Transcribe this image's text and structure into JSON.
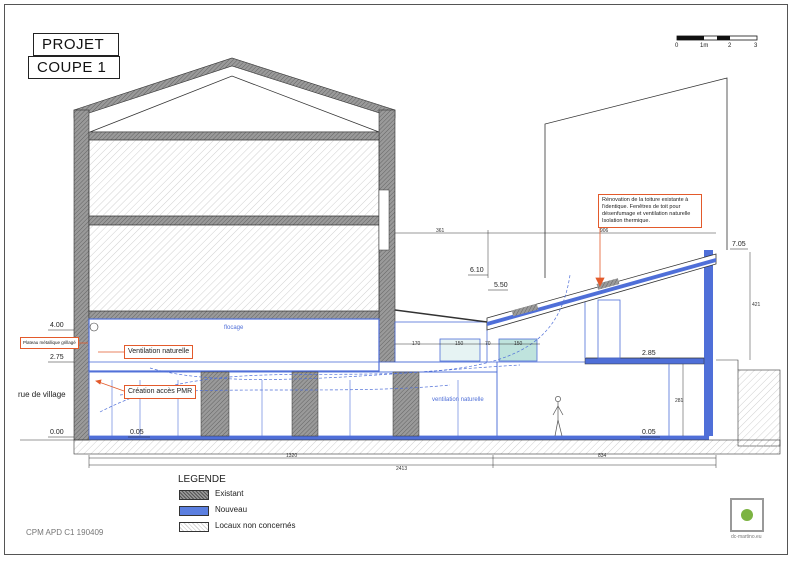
{
  "title": {
    "line1": "PROJET",
    "line2": "COUPE 1"
  },
  "scale": {
    "t0": "0",
    "t1": "1m",
    "t2": "2",
    "t3": "3"
  },
  "levels": {
    "l400": "4.00",
    "l275": "2.75",
    "l000": "0.00",
    "l005a": "0.05",
    "l005b": "0.05",
    "l610": "6.10",
    "l550": "5.50",
    "l285": "2.85",
    "l705": "7.05"
  },
  "labels": {
    "street": "rue de village",
    "flocage": "flocage",
    "ventilation_int": "ventilation naturelle"
  },
  "callouts": {
    "plateau": "Plateau métallique grillagé",
    "ventilation": "Ventilation naturelle",
    "pmr": "Création accès PMR",
    "renovation": "Rénovation de la toiture existante à l'identique. Fenêtres de toit pour désenfumage et ventilation naturelle Isolation thermique."
  },
  "dimensions": {
    "d361": "361",
    "d906": "906",
    "d170": "170",
    "d150a": "150",
    "d70": "70",
    "d150b": "150",
    "d1320": "1320",
    "d2413": "2413",
    "d834": "834",
    "d421": "421",
    "d281": "281"
  },
  "legend": {
    "title": "LEGENDE",
    "items": [
      {
        "label": "Existant",
        "color": "#808080"
      },
      {
        "label": "Nouveau",
        "color": "#5b7fe0"
      },
      {
        "label": "Locaux non concernés",
        "color": "#f2f2f2"
      }
    ]
  },
  "footer": {
    "ref": "CPM APD C1 190409",
    "logo_caption": "dc-martino.eu"
  },
  "colors": {
    "existing": "#888888",
    "new": "#4f6fd8",
    "accent": "#e35a2b"
  }
}
